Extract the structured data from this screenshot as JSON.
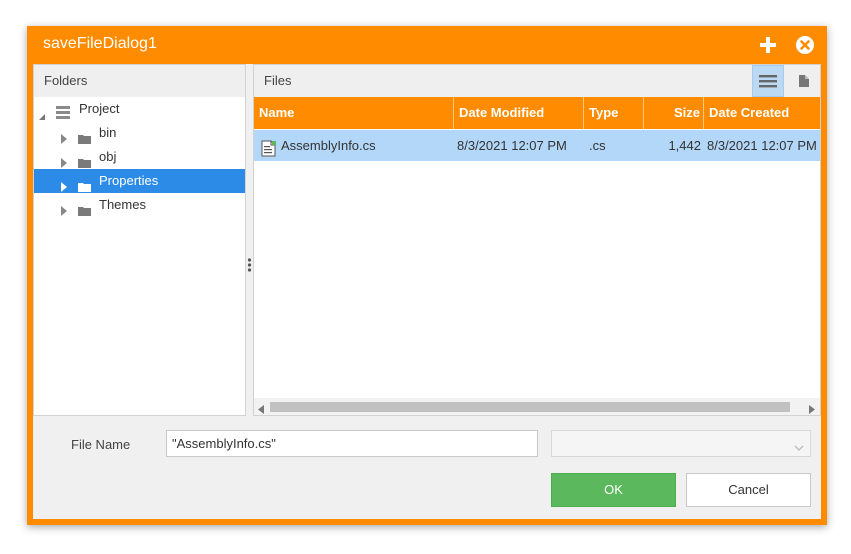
{
  "dialog": {
    "title": "saveFileDialog1"
  },
  "folders": {
    "header": "Folders",
    "tree": [
      {
        "label": "Project",
        "icon": "server-icon",
        "expanded": true
      },
      {
        "label": "bin",
        "icon": "folder-icon"
      },
      {
        "label": "obj",
        "icon": "folder-icon"
      },
      {
        "label": "Properties",
        "icon": "folder-icon",
        "selected": true
      },
      {
        "label": "Themes",
        "icon": "folder-icon"
      }
    ]
  },
  "files": {
    "header": "Files",
    "columns": [
      "Name",
      "Date Modified",
      "Type",
      "Size",
      "Date Created"
    ],
    "rows": [
      {
        "name": "AssemblyInfo.cs",
        "date_modified": "8/3/2021 12:07 PM",
        "type": ".cs",
        "size": "1,442",
        "date_created": "8/3/2021 12:07 PM"
      }
    ]
  },
  "footer": {
    "file_name_label": "File Name",
    "file_name_value": "\"AssemblyInfo.cs\"",
    "ok_label": "OK",
    "cancel_label": "Cancel"
  },
  "colors": {
    "accent": "#ff8c00",
    "selection": "#2b8be6",
    "row_selection": "#b3d7f8",
    "ok": "#5cb85c"
  }
}
